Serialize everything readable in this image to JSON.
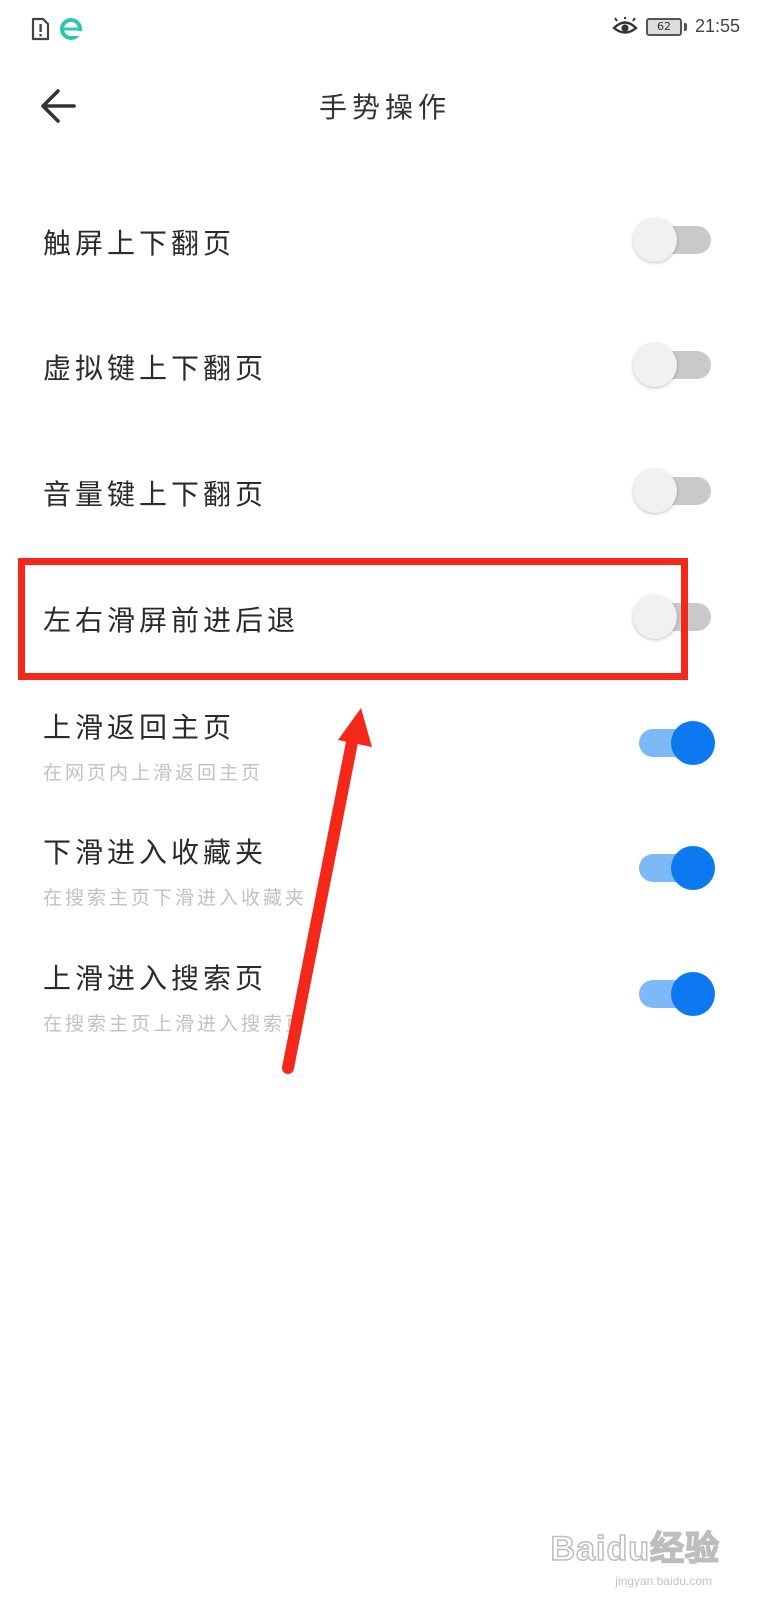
{
  "status_bar": {
    "time": "21:55",
    "battery_level": "62",
    "left_icons": [
      "sim-alert-icon",
      "browser-e-icon"
    ],
    "right_icons": [
      "eye-comfort-icon",
      "battery-icon"
    ]
  },
  "header": {
    "title": "手势操作",
    "back_icon": "back-arrow-icon"
  },
  "settings": [
    {
      "label": "触屏上下翻页",
      "subtitle": "",
      "enabled": false
    },
    {
      "label": "虚拟键上下翻页",
      "subtitle": "",
      "enabled": false
    },
    {
      "label": "音量键上下翻页",
      "subtitle": "",
      "enabled": false
    },
    {
      "label": "左右滑屏前进后退",
      "subtitle": "",
      "enabled": false
    },
    {
      "label": "上滑返回主页",
      "subtitle": "在网页内上滑返回主页",
      "enabled": true
    },
    {
      "label": "下滑进入收藏夹",
      "subtitle": "在搜索主页下滑进入收藏夹",
      "enabled": true
    },
    {
      "label": "上滑进入搜索页",
      "subtitle": "在搜索主页上滑进入搜索页",
      "enabled": true
    }
  ],
  "colors": {
    "toggle_on": "#0c79f0",
    "toggle_on_track": "#7cb9f6",
    "toggle_off_track": "#c9c9c9",
    "annotation": "#f3271a"
  },
  "watermark": {
    "logo": "Baidu经验",
    "url": "jingyan.baidu.com"
  }
}
